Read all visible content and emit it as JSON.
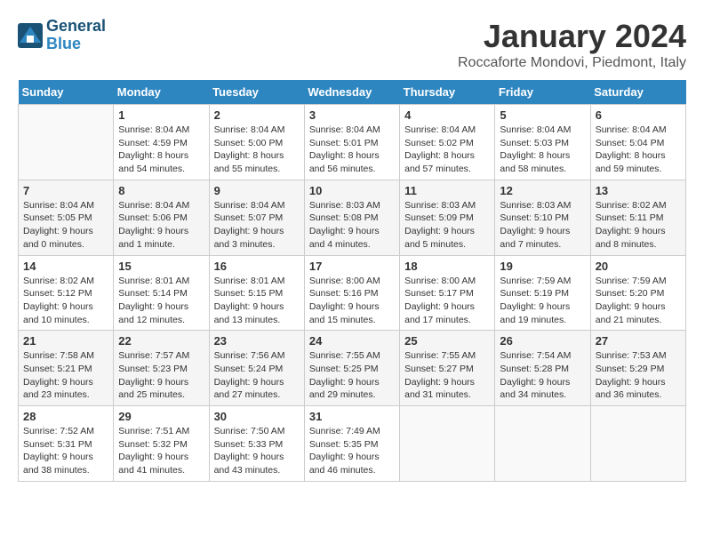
{
  "header": {
    "logo_line1": "General",
    "logo_line2": "Blue",
    "title": "January 2024",
    "location": "Roccaforte Mondovi, Piedmont, Italy"
  },
  "weekdays": [
    "Sunday",
    "Monday",
    "Tuesday",
    "Wednesday",
    "Thursday",
    "Friday",
    "Saturday"
  ],
  "weeks": [
    [
      {
        "day": "",
        "text": ""
      },
      {
        "day": "1",
        "text": "Sunrise: 8:04 AM\nSunset: 4:59 PM\nDaylight: 8 hours\nand 54 minutes."
      },
      {
        "day": "2",
        "text": "Sunrise: 8:04 AM\nSunset: 5:00 PM\nDaylight: 8 hours\nand 55 minutes."
      },
      {
        "day": "3",
        "text": "Sunrise: 8:04 AM\nSunset: 5:01 PM\nDaylight: 8 hours\nand 56 minutes."
      },
      {
        "day": "4",
        "text": "Sunrise: 8:04 AM\nSunset: 5:02 PM\nDaylight: 8 hours\nand 57 minutes."
      },
      {
        "day": "5",
        "text": "Sunrise: 8:04 AM\nSunset: 5:03 PM\nDaylight: 8 hours\nand 58 minutes."
      },
      {
        "day": "6",
        "text": "Sunrise: 8:04 AM\nSunset: 5:04 PM\nDaylight: 8 hours\nand 59 minutes."
      }
    ],
    [
      {
        "day": "7",
        "text": "Sunrise: 8:04 AM\nSunset: 5:05 PM\nDaylight: 9 hours\nand 0 minutes."
      },
      {
        "day": "8",
        "text": "Sunrise: 8:04 AM\nSunset: 5:06 PM\nDaylight: 9 hours\nand 1 minute."
      },
      {
        "day": "9",
        "text": "Sunrise: 8:04 AM\nSunset: 5:07 PM\nDaylight: 9 hours\nand 3 minutes."
      },
      {
        "day": "10",
        "text": "Sunrise: 8:03 AM\nSunset: 5:08 PM\nDaylight: 9 hours\nand 4 minutes."
      },
      {
        "day": "11",
        "text": "Sunrise: 8:03 AM\nSunset: 5:09 PM\nDaylight: 9 hours\nand 5 minutes."
      },
      {
        "day": "12",
        "text": "Sunrise: 8:03 AM\nSunset: 5:10 PM\nDaylight: 9 hours\nand 7 minutes."
      },
      {
        "day": "13",
        "text": "Sunrise: 8:02 AM\nSunset: 5:11 PM\nDaylight: 9 hours\nand 8 minutes."
      }
    ],
    [
      {
        "day": "14",
        "text": "Sunrise: 8:02 AM\nSunset: 5:12 PM\nDaylight: 9 hours\nand 10 minutes."
      },
      {
        "day": "15",
        "text": "Sunrise: 8:01 AM\nSunset: 5:14 PM\nDaylight: 9 hours\nand 12 minutes."
      },
      {
        "day": "16",
        "text": "Sunrise: 8:01 AM\nSunset: 5:15 PM\nDaylight: 9 hours\nand 13 minutes."
      },
      {
        "day": "17",
        "text": "Sunrise: 8:00 AM\nSunset: 5:16 PM\nDaylight: 9 hours\nand 15 minutes."
      },
      {
        "day": "18",
        "text": "Sunrise: 8:00 AM\nSunset: 5:17 PM\nDaylight: 9 hours\nand 17 minutes."
      },
      {
        "day": "19",
        "text": "Sunrise: 7:59 AM\nSunset: 5:19 PM\nDaylight: 9 hours\nand 19 minutes."
      },
      {
        "day": "20",
        "text": "Sunrise: 7:59 AM\nSunset: 5:20 PM\nDaylight: 9 hours\nand 21 minutes."
      }
    ],
    [
      {
        "day": "21",
        "text": "Sunrise: 7:58 AM\nSunset: 5:21 PM\nDaylight: 9 hours\nand 23 minutes."
      },
      {
        "day": "22",
        "text": "Sunrise: 7:57 AM\nSunset: 5:23 PM\nDaylight: 9 hours\nand 25 minutes."
      },
      {
        "day": "23",
        "text": "Sunrise: 7:56 AM\nSunset: 5:24 PM\nDaylight: 9 hours\nand 27 minutes."
      },
      {
        "day": "24",
        "text": "Sunrise: 7:55 AM\nSunset: 5:25 PM\nDaylight: 9 hours\nand 29 minutes."
      },
      {
        "day": "25",
        "text": "Sunrise: 7:55 AM\nSunset: 5:27 PM\nDaylight: 9 hours\nand 31 minutes."
      },
      {
        "day": "26",
        "text": "Sunrise: 7:54 AM\nSunset: 5:28 PM\nDaylight: 9 hours\nand 34 minutes."
      },
      {
        "day": "27",
        "text": "Sunrise: 7:53 AM\nSunset: 5:29 PM\nDaylight: 9 hours\nand 36 minutes."
      }
    ],
    [
      {
        "day": "28",
        "text": "Sunrise: 7:52 AM\nSunset: 5:31 PM\nDaylight: 9 hours\nand 38 minutes."
      },
      {
        "day": "29",
        "text": "Sunrise: 7:51 AM\nSunset: 5:32 PM\nDaylight: 9 hours\nand 41 minutes."
      },
      {
        "day": "30",
        "text": "Sunrise: 7:50 AM\nSunset: 5:33 PM\nDaylight: 9 hours\nand 43 minutes."
      },
      {
        "day": "31",
        "text": "Sunrise: 7:49 AM\nSunset: 5:35 PM\nDaylight: 9 hours\nand 46 minutes."
      },
      {
        "day": "",
        "text": ""
      },
      {
        "day": "",
        "text": ""
      },
      {
        "day": "",
        "text": ""
      }
    ]
  ]
}
